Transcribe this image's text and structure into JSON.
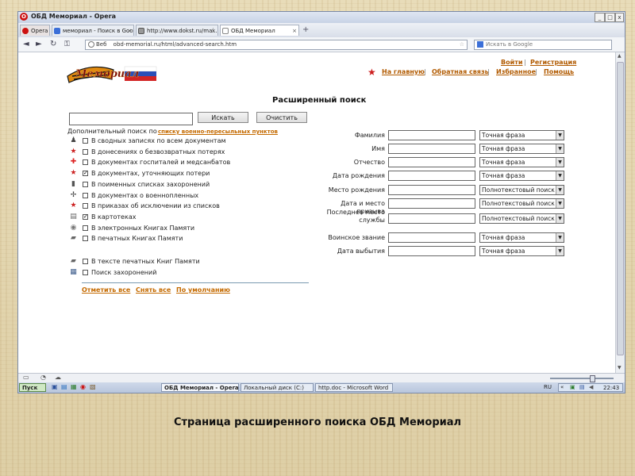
{
  "window": {
    "title": "ОБД Мемориал - Opera",
    "controls": [
      "_",
      "□",
      "x"
    ]
  },
  "tabs": [
    {
      "label": "Opera"
    },
    {
      "label": "мемориал - Поиск в Goo..."
    },
    {
      "label": "http://www.dokst.ru/mai..."
    },
    {
      "label": "ОБД Мемориал"
    }
  ],
  "address": {
    "back": "◄",
    "forward": "►",
    "reload": "↻",
    "key": "⚿",
    "web_label": "Веб",
    "url": "obd-memorial.ru/html/advanced-search.htm",
    "search_placeholder": "Искать в Google"
  },
  "logo_text": "Мемориал",
  "top_links": {
    "login": "Войти",
    "register": "Регистрация",
    "home": "На главную",
    "feedback": "Обратная связь",
    "favorites": "Избранное",
    "help": "Помощь",
    "sep": "|"
  },
  "page_title": "Расширенный поиск",
  "search_button": "Искать",
  "clear_button": "Очистить",
  "additional_label": "Дополнительный поиск по",
  "additional_link": "списку военно-пересыльных пунктов",
  "sources": [
    {
      "label": "В сводных записях по всем документам",
      "checked": false,
      "icon": "soldier-icon",
      "glyph": "♟",
      "color": "#444444"
    },
    {
      "label": "В донесениях о безвозвратных потерях",
      "checked": false,
      "icon": "star-icon",
      "glyph": "★",
      "color": "#cc2222"
    },
    {
      "label": "В документах госпиталей и медсанбатов",
      "checked": false,
      "icon": "red-cross-icon",
      "glyph": "✚",
      "color": "#dd2222"
    },
    {
      "label": "В документах, уточняющих потери",
      "checked": true,
      "icon": "star-pen-icon",
      "glyph": "★",
      "color": "#cc2222"
    },
    {
      "label": "В поименных списках захоронений",
      "checked": false,
      "icon": "monument-icon",
      "glyph": "▮",
      "color": "#555555"
    },
    {
      "label": "В документах о военнопленных",
      "checked": false,
      "icon": "barbed-wire-icon",
      "glyph": "✢",
      "color": "#333333"
    },
    {
      "label": "В приказах об исключении из списков",
      "checked": false,
      "icon": "star-dash-icon",
      "glyph": "★",
      "color": "#cc2222"
    },
    {
      "label": "В картотеках",
      "checked": true,
      "icon": "card-file-icon",
      "glyph": "▤",
      "color": "#666666"
    },
    {
      "label": "В электронных Книгах Памяти",
      "checked": false,
      "icon": "e-book-icon",
      "glyph": "◉",
      "color": "#777777"
    },
    {
      "label": "В печатных Книгах Памяти",
      "checked": false,
      "icon": "book-icon",
      "glyph": "▰",
      "color": "#666666"
    }
  ],
  "extra_sources": [
    {
      "label": "В тексте печатных Книг Памяти",
      "checked": false,
      "icon": "book-text-icon",
      "glyph": "▰",
      "color": "#666666"
    },
    {
      "label": "Поиск захоронений",
      "checked": false,
      "icon": "grave-search-icon",
      "glyph": "▦",
      "color": "#3a5a8a"
    }
  ],
  "bulk_links": {
    "mark_all": "Отметить все",
    "clear_all": "Снять все",
    "default": "По умолчанию"
  },
  "fields": [
    {
      "label": "Фамилия",
      "mode": "Точная фраза"
    },
    {
      "label": "Имя",
      "mode": "Точная фраза"
    },
    {
      "label": "Отчество",
      "mode": "Точная фраза"
    },
    {
      "label": "Дата рождения",
      "mode": "Точная фраза"
    },
    {
      "label": "Место рождения",
      "mode": "Полнотекстовый поиск"
    },
    {
      "label": "Дата и место призыва",
      "mode": "Полнотекстовый поиск"
    },
    {
      "label": "Последнее место службы",
      "mode": "Полнотекстовый поиск"
    },
    {
      "label": "Воинское звание",
      "mode": "Точная фраза"
    },
    {
      "label": "Дата выбытия",
      "mode": "Точная фраза"
    }
  ],
  "taskbar": {
    "start": "Пуск",
    "opera": "ОБД Мемориал - Opera",
    "disk": "Локальный диск (C:)",
    "word": "http.doc - Microsoft Word",
    "lang": "RU",
    "clock": "22:43"
  },
  "caption": "Страница расширенного поиска ОБД Мемориал"
}
